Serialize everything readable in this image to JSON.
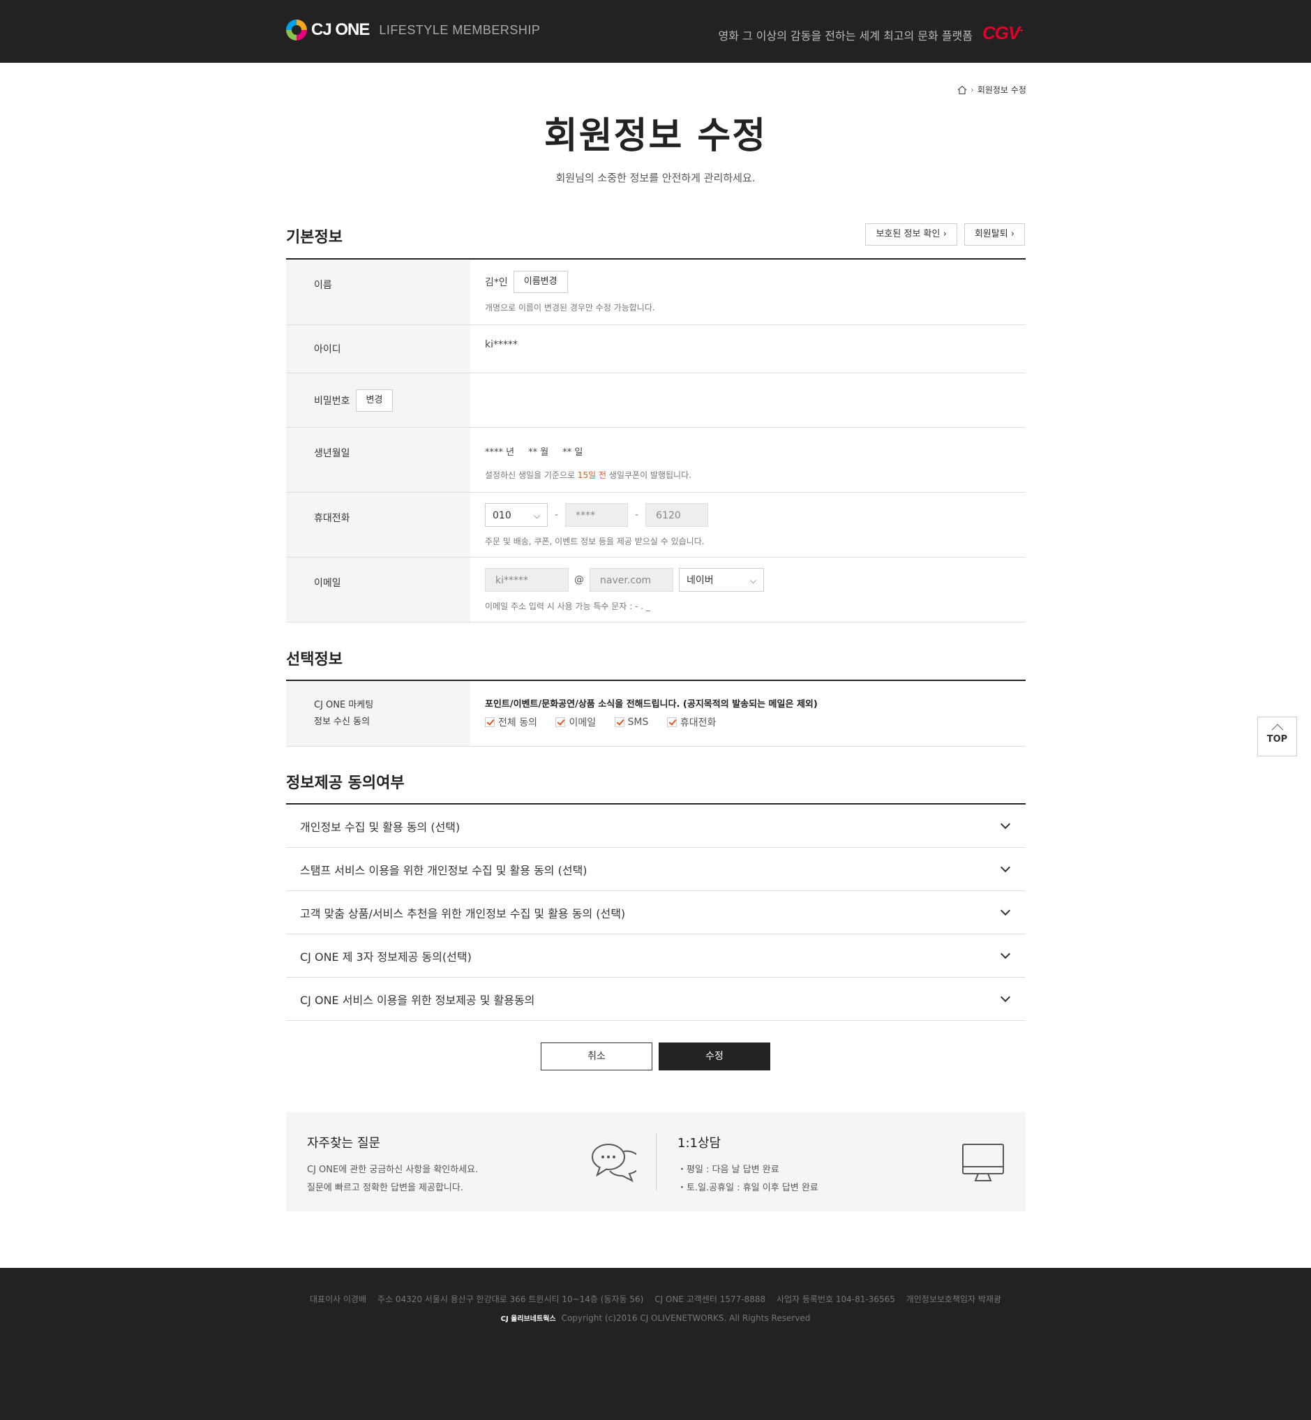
{
  "header": {
    "brand": "CJ ONE",
    "subtitle": "LIFESTYLE MEMBERSHIP",
    "tagline": "영화 그 이상의 감동을 전하는 세계 최고의 문화 플랫폼",
    "partner": "CGV"
  },
  "breadcrumb": {
    "current": "회원정보 수정"
  },
  "page": {
    "title": "회원정보 수정",
    "description": "회원님의 소중한 정보를 안전하게 관리하세요."
  },
  "basic": {
    "title": "기본정보",
    "protected_btn": "보호된 정보 확인",
    "withdraw_btn": "회원탈퇴",
    "name_label": "이름",
    "name_value": "김*인",
    "name_change_btn": "이름변경",
    "name_help": "개명으로 이름이 변경된 경우만 수정 가능합니다.",
    "id_label": "아이디",
    "id_value": "ki*****",
    "pw_label": "비밀번호",
    "pw_change_btn": "변경",
    "birth_label": "생년월일",
    "birth_year": "**** 년",
    "birth_month": "** 월",
    "birth_day": "** 일",
    "birth_help_a": "설정하신 생일을 기준으로",
    "birth_help_hl": "15일 전",
    "birth_help_b": "생일쿠폰이 발행됩니다.",
    "phone_label": "휴대전화",
    "phone_prefix": "010",
    "phone_mid": "****",
    "phone_last": "6120",
    "phone_help": "주문 및 배송, 쿠폰, 이벤트 정보 등을 제공 받으실 수 있습니다.",
    "email_label": "이메일",
    "email_id": "ki*****",
    "email_at": "@",
    "email_domain": "naver.com",
    "email_select": "네이버",
    "email_help": "이메일 주소 입력 시 사용 가능 특수 문자 : - . _"
  },
  "optional": {
    "title": "선택정보",
    "label_line1": "CJ ONE 마케팅",
    "label_line2": "정보 수신 동의",
    "headline": "포인트/이벤트/문화공연/상품 소식을 전해드립니다. (공지목적의 발송되는 메일은 제외)",
    "checks": [
      "전체 동의",
      "이메일",
      "SMS",
      "휴대전화"
    ]
  },
  "consent": {
    "title": "정보제공 동의여부",
    "items": [
      "개인정보 수집 및 활용 동의 (선택)",
      "스탬프 서비스 이용을 위한 개인정보 수집 및 활용 동의 (선택)",
      "고객 맞춤 상품/서비스 추천을 위한 개인정보 수집 및 활용 동의 (선택)",
      "CJ ONE 제 3자 정보제공 동의(선택)",
      "CJ ONE 서비스 이용을 위한 정보제공 및 활용동의"
    ]
  },
  "actions": {
    "cancel": "취소",
    "submit": "수정"
  },
  "help": {
    "faq_title": "자주찾는 질문",
    "faq_line1": "CJ ONE에 관한 궁금하신 사항을 확인하세요.",
    "faq_line2": "질문에 빠르고 정확한 답변을 제공합니다.",
    "qna_title": "1:1상담",
    "qna_line1": "・평일 : 다음 날 답변 완료",
    "qna_line2": "・토.일.공휴일 : 휴일 이후 답변 완료"
  },
  "top_button": "TOP",
  "footer": {
    "ceo": "대표이사 이경배",
    "address": "주소 04320 서울시 용산구 한강대로 366 트윈시티 10~14층 (동자동 56)",
    "cs": "CJ ONE 고객센터 1577-8888",
    "biz": "사업자 등록번호 104-81-36565",
    "privacy": "개인정보보호책임자 박재광",
    "company_logo": "CJ 올리브네트웍스",
    "copyright": "Copyright (c)2016 CJ OLIVENETWORKS. All Rights Reserved"
  },
  "colors": {
    "accent": "#e05a1e",
    "dark": "#222222",
    "cgv": "#e4002b"
  }
}
